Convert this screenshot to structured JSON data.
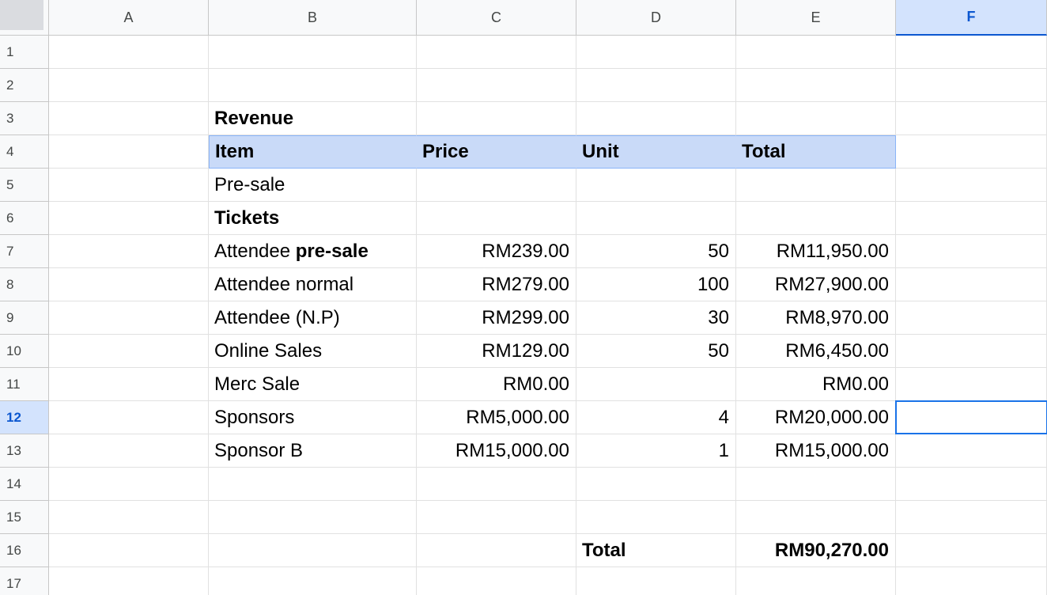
{
  "columns": [
    "A",
    "B",
    "C",
    "D",
    "E",
    "F"
  ],
  "rows": [
    "1",
    "2",
    "3",
    "4",
    "5",
    "6",
    "7",
    "8",
    "9",
    "10",
    "11",
    "12",
    "13",
    "14",
    "15",
    "16",
    "17"
  ],
  "active": {
    "column": "F",
    "row": "12"
  },
  "section_title": "Revenue",
  "table_header": {
    "item": "Item",
    "price": "Price",
    "unit": "Unit",
    "total": "Total"
  },
  "row5_label": "Pre-sale",
  "row6_label": "Tickets",
  "items": [
    {
      "row": "7",
      "item_prefix": "Attendee ",
      "item_bold": "pre-sale",
      "price": "RM239.00",
      "unit": "50",
      "total": "RM11,950.00"
    },
    {
      "row": "8",
      "item_prefix": "Attendee normal",
      "item_bold": "",
      "price": "RM279.00",
      "unit": "100",
      "total": "RM27,900.00"
    },
    {
      "row": "9",
      "item_prefix": "Attendee (N.P)",
      "item_bold": "",
      "price": "RM299.00",
      "unit": "30",
      "total": "RM8,970.00"
    },
    {
      "row": "10",
      "item_prefix": "Online Sales",
      "item_bold": "",
      "price": "RM129.00",
      "unit": "50",
      "total": "RM6,450.00"
    },
    {
      "row": "11",
      "item_prefix": "Merc Sale",
      "item_bold": "",
      "price": "RM0.00",
      "unit": "",
      "total": "RM0.00"
    },
    {
      "row": "12",
      "item_prefix": "Sponsors",
      "item_bold": "",
      "price": "RM5,000.00",
      "unit": "4",
      "total": "RM20,000.00"
    },
    {
      "row": "13",
      "item_prefix": "Sponsor B",
      "item_bold": "",
      "price": "RM15,000.00",
      "unit": "1",
      "total": "RM15,000.00"
    }
  ],
  "grand_total": {
    "label": "Total",
    "value": "RM90,270.00"
  }
}
